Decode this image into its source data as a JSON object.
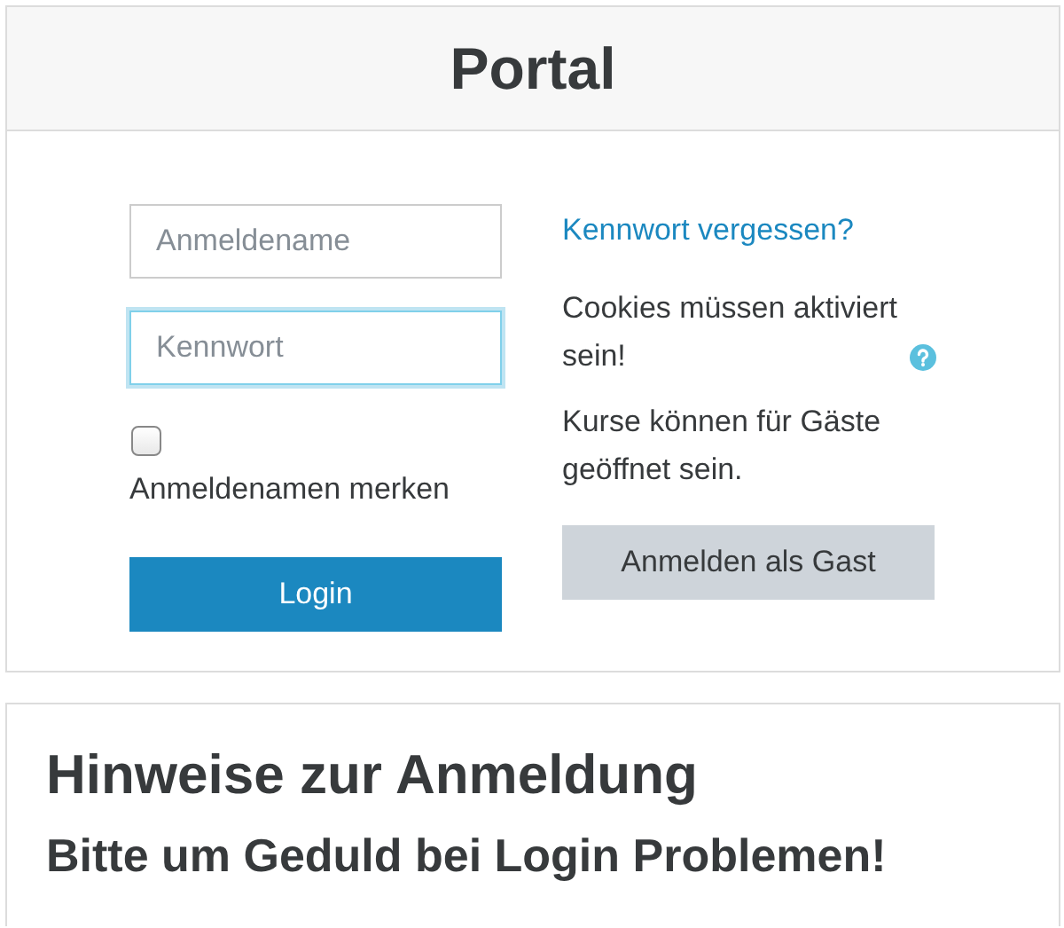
{
  "login_card": {
    "title": "Portal",
    "fields": [
      {
        "placeholder": "Anmeldename",
        "focused": false
      },
      {
        "placeholder": "Kennwort",
        "focused": true
      }
    ],
    "remember": {
      "label": "Anmeldenamen merken",
      "checked": false
    },
    "login_button": "Login",
    "forgot_link": "Kennwort vergessen?",
    "cookies_note": "Cookies müssen aktiviert sein!",
    "guest_note": "Kurse können für Gäste geöffnet sein.",
    "guest_button": "Anmelden als Gast"
  },
  "info_card": {
    "title": "Hinweise zur Anmeldung",
    "subtitle": "Bitte um Geduld bei Login Problemen!"
  }
}
